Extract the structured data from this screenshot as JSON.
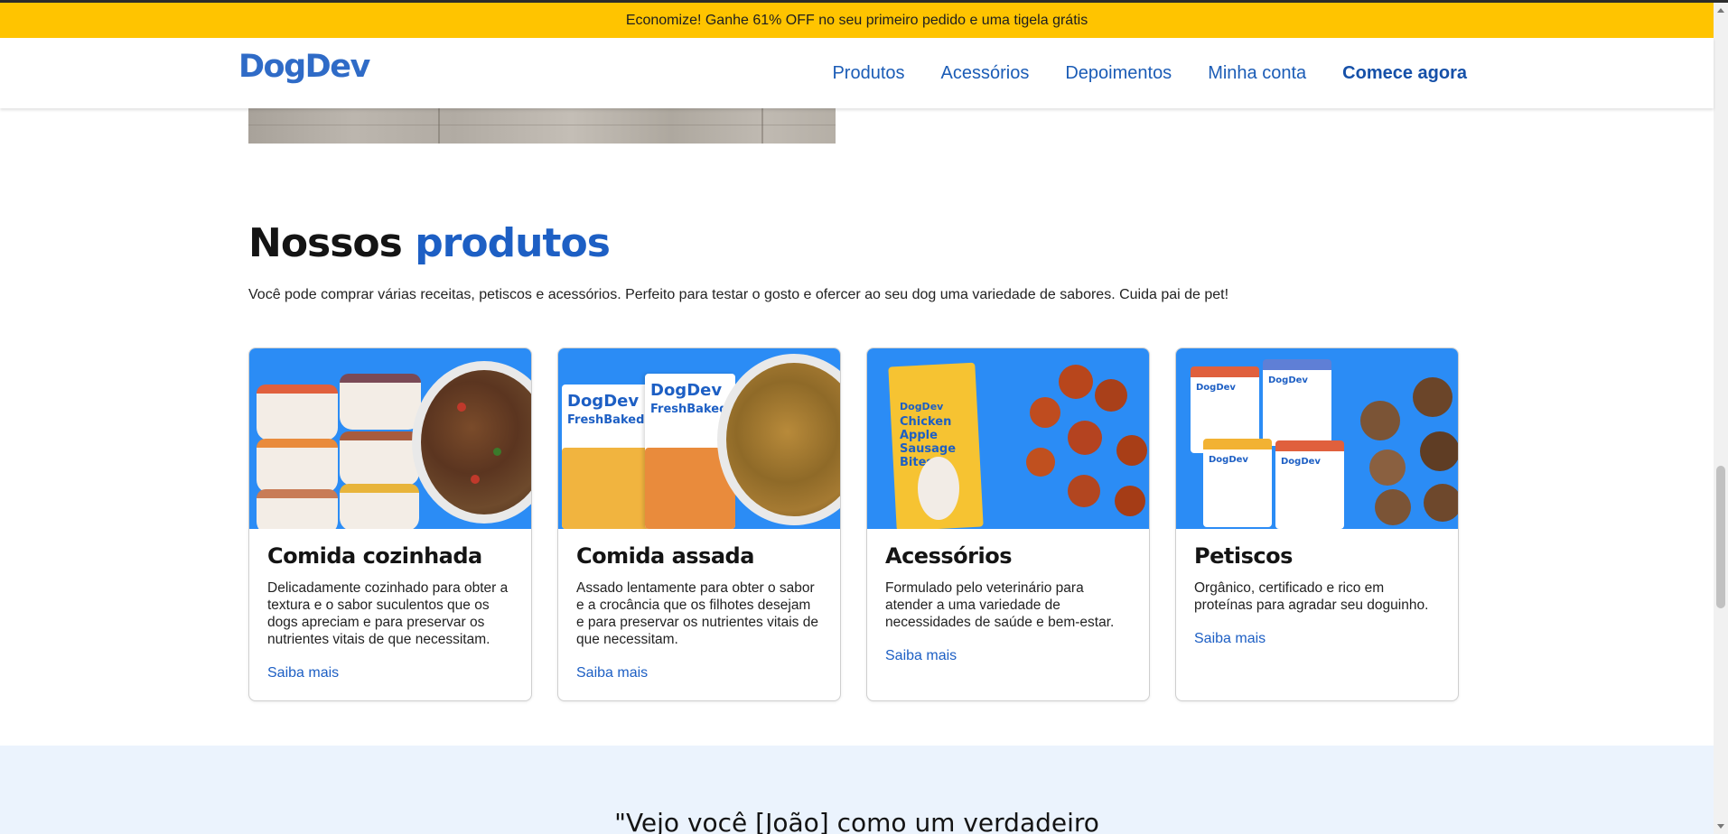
{
  "promo": {
    "text": "Economize! Ganhe 61% OFF no seu primeiro pedido e uma tigela grátis"
  },
  "header": {
    "logo": "DogDev",
    "nav": [
      {
        "label": "Produtos"
      },
      {
        "label": "Acessórios"
      },
      {
        "label": "Depoimentos"
      },
      {
        "label": "Minha conta"
      },
      {
        "label": "Comece agora"
      }
    ]
  },
  "products_section": {
    "title_part1": "Nossos",
    "title_part2": "produtos",
    "description": "Você pode comprar várias receitas, petiscos e acessórios. Perfeito para testar o gosto e ofercer ao seu dog uma variedade de sabores. Cuida pai de pet!",
    "cards": [
      {
        "title": "Comida cozinhada",
        "text": "Delicadamente cozinhado para obter a textura e o sabor suculentos que os dogs apreciam e para preservar os nutrientes vitais de que necessitam.",
        "link": "Saiba mais"
      },
      {
        "title": "Comida assada",
        "text": "Assado lentamente para obter o sabor e a crocância que os filhotes desejam e para preservar os nutrientes vitais de que necessitam.",
        "link": "Saiba mais"
      },
      {
        "title": "Acessórios",
        "text": "Formulado pelo veterinário para atender a uma variedade de necessidades de saúde e bem-estar.",
        "link": "Saiba mais"
      },
      {
        "title": "Petiscos",
        "text": "Orgânico, certificado e rico em proteínas para agradar seu doguinho.",
        "link": "Saiba mais"
      }
    ]
  },
  "testimonial": {
    "quote": "\"Vejo você [João] como um verdadeiro"
  },
  "colors": {
    "promo_bg": "#ffc400",
    "brand_blue": "#1d5fc4",
    "card_art_bg": "#2b8cf5",
    "testimonial_bg": "#ebf3fd"
  }
}
